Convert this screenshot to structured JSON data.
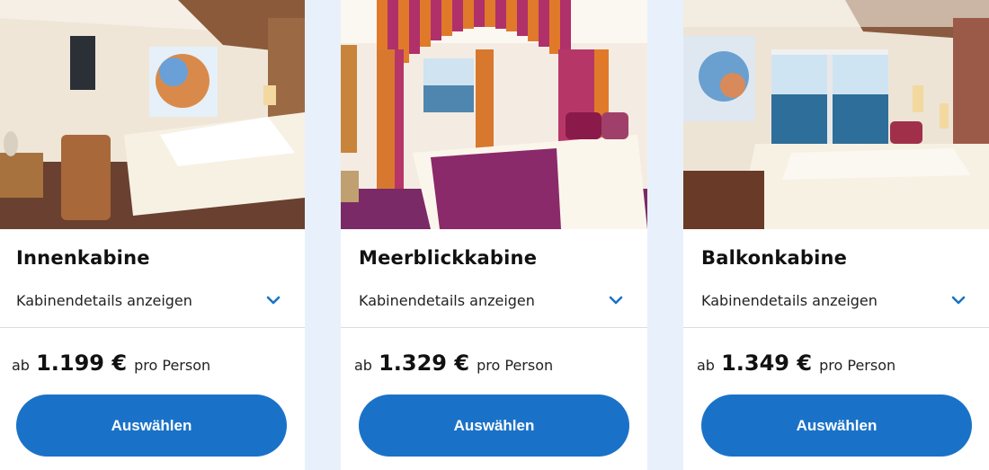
{
  "colors": {
    "page_background": "#e8f1fb",
    "card_background": "#ffffff",
    "button": "#1a72c8",
    "chevron": "#1a72c8"
  },
  "cabins": [
    {
      "title": "Innenkabine",
      "details_label": "Kabinendetails anzeigen",
      "price_prefix": "ab",
      "price": "1.199 €",
      "price_suffix": "pro Person",
      "button_label": "Auswählen",
      "image": "interior-cabin-photo"
    },
    {
      "title": "Meerblickkabine",
      "details_label": "Kabinendetails anzeigen",
      "price_prefix": "ab",
      "price": "1.329 €",
      "price_suffix": "pro Person",
      "button_label": "Auswählen",
      "image": "sea-view-cabin-photo"
    },
    {
      "title": "Balkonkabine",
      "details_label": "Kabinendetails anzeigen",
      "price_prefix": "ab",
      "price": "1.349 €",
      "price_suffix": "pro Person",
      "button_label": "Auswählen",
      "image": "balcony-cabin-photo"
    }
  ]
}
